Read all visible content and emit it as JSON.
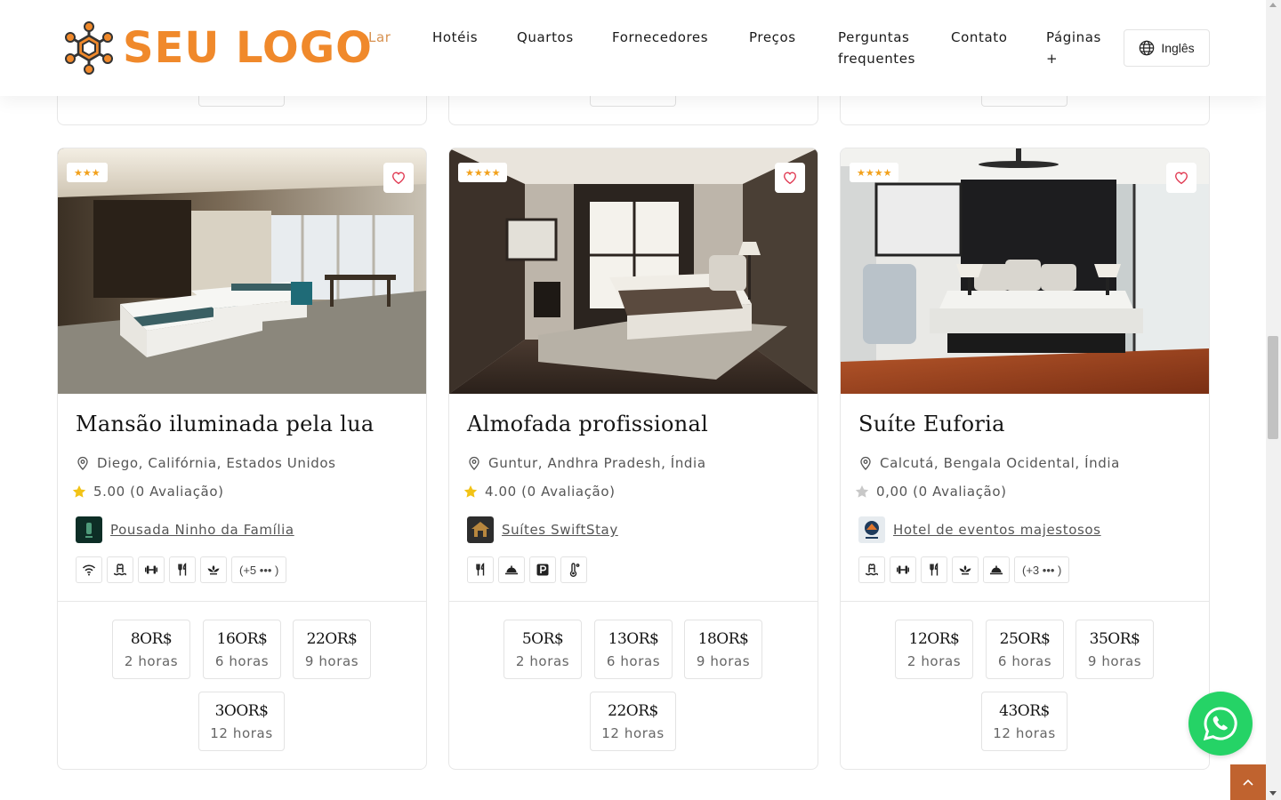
{
  "brand": {
    "logo_text": "SEU LOGO",
    "accent": "#f0892b"
  },
  "nav": {
    "items": [
      {
        "label": "Lar",
        "active": true
      },
      {
        "label": "Hotéis"
      },
      {
        "label": "Quartos"
      },
      {
        "label": "Fornecedores"
      },
      {
        "label": "Preços"
      },
      {
        "label": "Perguntas",
        "label2": "frequentes"
      },
      {
        "label": "Contato"
      },
      {
        "label": "Páginas",
        "label2": "+"
      }
    ],
    "language": "Inglês"
  },
  "cards": [
    {
      "stars": 3,
      "title": "Mansão iluminada pela lua",
      "location": "Diego, Califórnia, Estados Unidos",
      "rating_text": "5.00 (0 Avaliação)",
      "rating_icon_color": "#f2c316",
      "vendor": "Pousada Ninho da Família",
      "amenities": [
        "wifi-icon",
        "pool-icon",
        "gym-icon",
        "restaurant-icon",
        "spa-icon"
      ],
      "more": "(+5 ••• )",
      "prices": [
        {
          "amount": "8OR$",
          "hours": "2 horas"
        },
        {
          "amount": "16OR$",
          "hours": "6 horas"
        },
        {
          "amount": "22OR$",
          "hours": "9 horas"
        },
        {
          "amount": "3OOR$",
          "hours": "12 horas"
        }
      ]
    },
    {
      "stars": 4,
      "title": "Almofada profissional",
      "location": "Guntur, Andhra Pradesh, Índia",
      "rating_text": "4.00 (0 Avaliação)",
      "rating_icon_color": "#f2c316",
      "vendor": "Suítes SwiftStay",
      "amenities": [
        "restaurant-icon",
        "room-service-icon",
        "parking-icon",
        "thermometer-icon"
      ],
      "more": "",
      "prices": [
        {
          "amount": "5OR$",
          "hours": "2 horas"
        },
        {
          "amount": "13OR$",
          "hours": "6 horas"
        },
        {
          "amount": "18OR$",
          "hours": "9 horas"
        },
        {
          "amount": "22OR$",
          "hours": "12 horas"
        }
      ]
    },
    {
      "stars": 4,
      "title": "Suíte Euforia",
      "location": "Calcutá, Bengala Ocidental, Índia",
      "rating_text": "0,00 (0 Avaliação)",
      "rating_icon_color": "#c8c8c8",
      "vendor": "Hotel de eventos majestosos",
      "amenities": [
        "pool-icon",
        "gym-icon",
        "restaurant-icon",
        "spa-icon",
        "room-service-icon"
      ],
      "more": "(+3 ••• )",
      "prices": [
        {
          "amount": "12OR$",
          "hours": "2 horas"
        },
        {
          "amount": "25OR$",
          "hours": "6 horas"
        },
        {
          "amount": "35OR$",
          "hours": "9 horas"
        },
        {
          "amount": "43OR$",
          "hours": "12 horas"
        }
      ]
    }
  ]
}
